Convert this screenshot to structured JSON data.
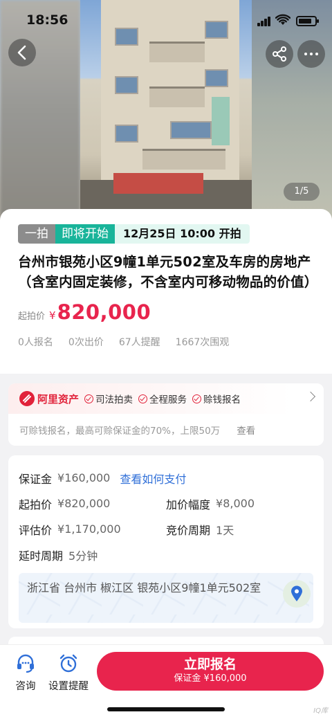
{
  "status_bar": {
    "time": "18:56"
  },
  "gallery": {
    "counter": "1/5"
  },
  "auction": {
    "round_tag": "一拍",
    "status_tag": "即将开始",
    "start_time": "12月25日 10:00 开拍",
    "title": "台州市银苑小区9幢1单元502室及车房的房地产（含室内固定装修，不含室内可移动物品的价值）",
    "price_label": "起拍价",
    "currency": "¥",
    "price": "820,000",
    "stats": [
      "0人报名",
      "0次出价",
      "67人提醒",
      "1667次围观"
    ]
  },
  "ali": {
    "brand": "阿里资产",
    "features": [
      "司法拍卖",
      "全程服务",
      "赊钱报名"
    ],
    "note": "可赊钱报名，最高可赊保证金的70%，上限50万",
    "see": "查看"
  },
  "info": {
    "deposit_label": "保证金",
    "deposit_value": "¥160,000",
    "pay_link": "查看如何支付",
    "start_price_label": "起拍价",
    "start_price_value": "¥820,000",
    "increment_label": "加价幅度",
    "increment_value": "¥8,000",
    "appraisal_label": "评估价",
    "appraisal_value": "¥1,170,000",
    "cycle_label": "竞价周期",
    "cycle_value": "1天",
    "delay_label": "延时周期",
    "delay_value": "5分钟",
    "address": "浙江省 台州市 椒江区 银苑小区9幢1单元502室"
  },
  "bottom_bar": {
    "consult": "咨询",
    "remind": "设置提醒",
    "signup": "立即报名",
    "signup_sub": "保证金 ¥160,000"
  },
  "watermark": "IQ库",
  "colors": {
    "brand_red": "#e8244d",
    "teal": "#19b49a",
    "link_blue": "#2f6fd8"
  }
}
